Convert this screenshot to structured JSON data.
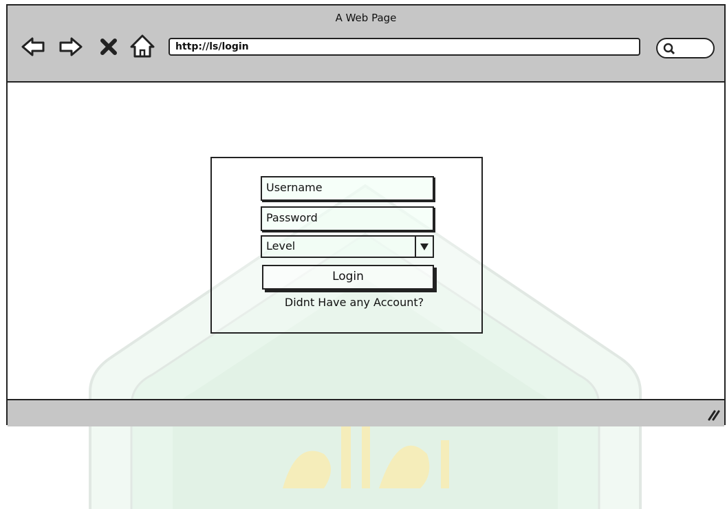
{
  "window": {
    "title": "A Web Page",
    "url": "http://ls/login"
  },
  "nav": {
    "back_icon": "back-arrow-icon",
    "forward_icon": "forward-arrow-icon",
    "stop_icon": "close-icon",
    "home_icon": "home-icon",
    "search_icon": "search-icon"
  },
  "login": {
    "username_placeholder": "Username",
    "password_placeholder": "Password",
    "level_value": "Level",
    "login_button": "Login",
    "register_link": "Didnt Have any Account?"
  },
  "colors": {
    "chrome": "#c6c6c6",
    "border": "#222222",
    "watermark_green": "#cdebd6",
    "watermark_gold": "#f2df7a"
  }
}
